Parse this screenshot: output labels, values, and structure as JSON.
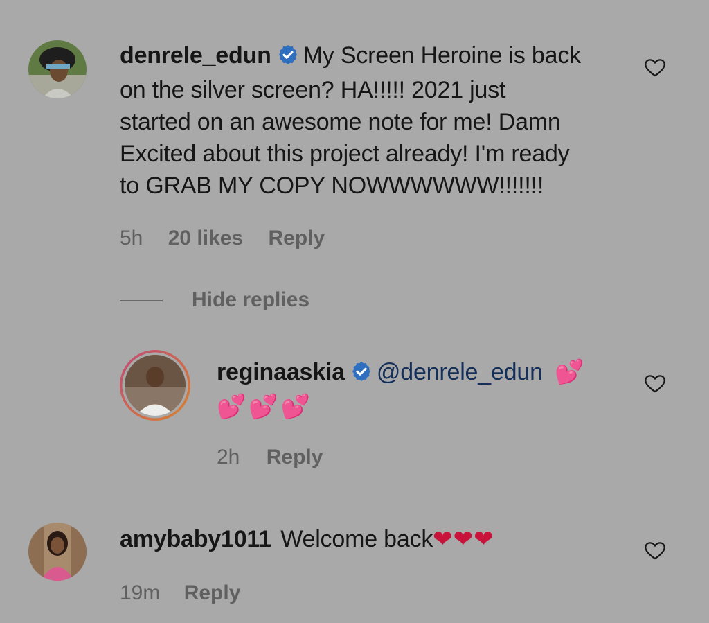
{
  "comments": [
    {
      "username": "denrele_edun",
      "verified": true,
      "text_lines": [
        "My Screen Heroine is back",
        "on the silver screen? HA!!!!! 2021 just",
        "started on an awesome note for me! Damn",
        "Excited about this project already! I'm ready",
        "to GRAB MY COPY NOWWWWWW!!!!!!!"
      ],
      "time": "5h",
      "likes": "20 likes",
      "reply_label": "Reply",
      "hide_replies_label": "Hide replies",
      "replies": [
        {
          "username": "reginaaskia",
          "verified": true,
          "mention": "@denrele_edun",
          "emoji_inline": "💕",
          "emoji_line": "💕💕💕",
          "time": "2h",
          "reply_label": "Reply"
        }
      ]
    },
    {
      "username": "amybaby1011",
      "verified": false,
      "text": "Welcome back",
      "emoji": "❤❤❤",
      "time": "19m",
      "reply_label": "Reply"
    }
  ],
  "icons": {
    "like": "heart-outline-icon",
    "verified": "verified-badge-icon"
  },
  "colors": {
    "background": "#a9a9a9",
    "text": "#161616",
    "meta": "#606060",
    "verified_badge": "#2f6fbf",
    "mention": "#14305a",
    "red_heart": "#c8143a",
    "pink_heart": "#d63a8a",
    "story_ring_start": "#c04a78",
    "story_ring_end": "#d9822b"
  }
}
